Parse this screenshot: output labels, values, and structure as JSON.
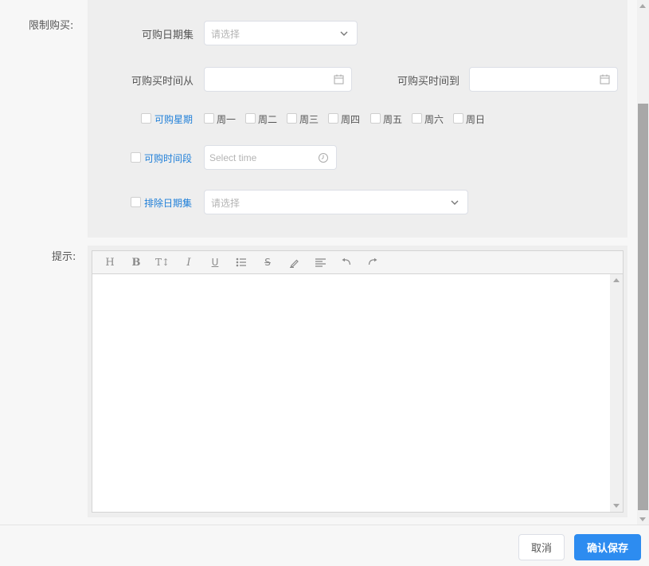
{
  "form": {
    "restrict_label": "限制购买:",
    "date_set": {
      "label": "可购日期集",
      "placeholder": "请选择"
    },
    "buy_time_from": {
      "label": "可购买时间从",
      "value": ""
    },
    "buy_time_to": {
      "label": "可购买时间到",
      "value": ""
    },
    "weekdays": {
      "label": "可购星期",
      "days": [
        "周一",
        "周二",
        "周三",
        "周四",
        "周五",
        "周六",
        "周日"
      ]
    },
    "time_period": {
      "label": "可购时间段",
      "placeholder": "Select time"
    },
    "exclude_date_set": {
      "label": "排除日期集",
      "placeholder": "请选择"
    },
    "tip_label": "提示:"
  },
  "editor": {
    "toolbar": [
      "heading",
      "bold",
      "text-size",
      "italic",
      "underline",
      "list",
      "strikethrough",
      "highlighter",
      "align",
      "undo",
      "redo"
    ],
    "toolbar_glyphs": {
      "heading": "H",
      "bold": "B",
      "text-size": "T↕",
      "italic": "I",
      "underline": "U",
      "strikethrough": "S"
    }
  },
  "footer": {
    "cancel_label": "取消",
    "save_label": "确认保存"
  },
  "colors": {
    "primary": "#2d8cf0",
    "link_blue": "#1f7fd8",
    "panel_bg": "#eeeeee"
  }
}
